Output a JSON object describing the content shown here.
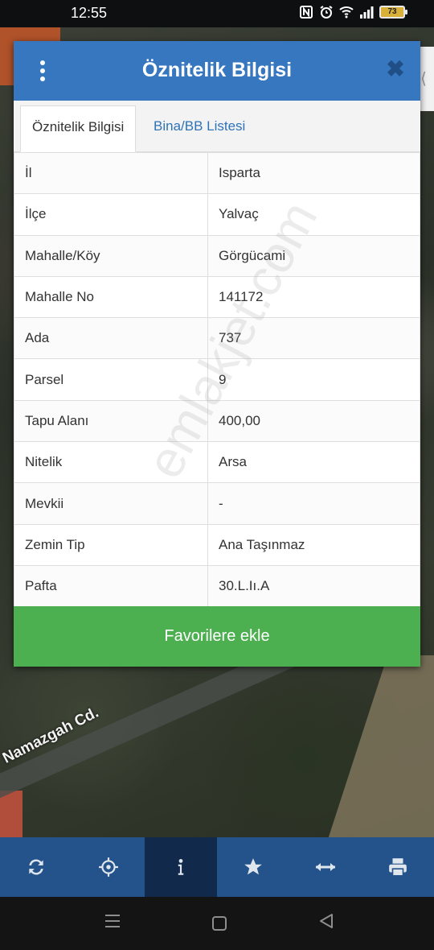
{
  "status_bar": {
    "time": "12:55",
    "battery_level": "73",
    "icons": [
      "nfc-icon",
      "alarm-icon",
      "wifi-icon",
      "signal-icon",
      "battery-icon"
    ]
  },
  "map": {
    "street_label": "Namazgah Cd."
  },
  "dialog": {
    "title": "Öznitelik Bilgisi",
    "tabs": [
      {
        "label": "Öznitelik Bilgisi",
        "active": true
      },
      {
        "label": "Bina/BB Listesi",
        "active": false
      }
    ],
    "rows": [
      {
        "key": "İl",
        "value": "Isparta"
      },
      {
        "key": "İlçe",
        "value": "Yalvaç"
      },
      {
        "key": "Mahalle/Köy",
        "value": "Görgücami"
      },
      {
        "key": "Mahalle No",
        "value": "141172"
      },
      {
        "key": "Ada",
        "value": "737"
      },
      {
        "key": "Parsel",
        "value": "9"
      },
      {
        "key": "Tapu Alanı",
        "value": "400,00"
      },
      {
        "key": "Nitelik",
        "value": "Arsa"
      },
      {
        "key": "Mevkii",
        "value": "-"
      },
      {
        "key": "Zemin Tip",
        "value": "Ana Taşınmaz"
      },
      {
        "key": "Pafta",
        "value": "30.L.Iı.A"
      }
    ],
    "favorite_button": "Favorilere ekle"
  },
  "watermark": "emlakjet.com",
  "toolbar": {
    "buttons": [
      "refresh-icon",
      "locate-icon",
      "info-icon",
      "star-icon",
      "measure-icon",
      "print-icon"
    ],
    "active": "info-icon"
  },
  "colors": {
    "header_blue": "#3777bf",
    "favorite_green": "#4caf50",
    "toolbar_blue": "#24528a",
    "toolbar_active": "#11294a"
  }
}
